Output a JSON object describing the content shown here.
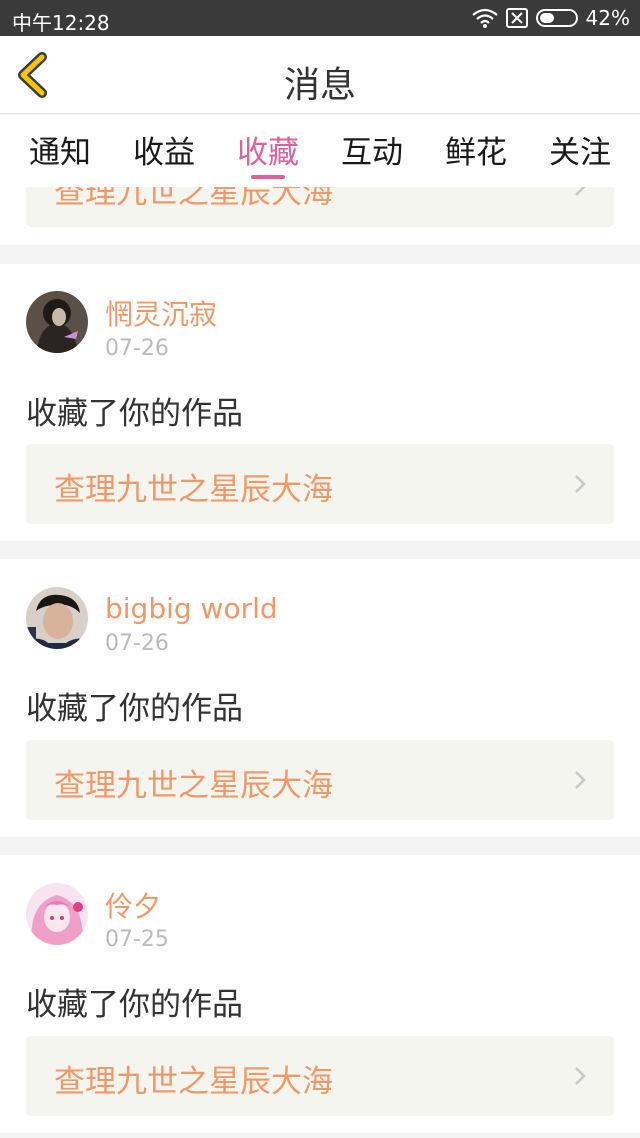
{
  "status_bar": {
    "time": "中午12:28",
    "battery": "42%",
    "battery_level": 0.42,
    "icons": [
      "wifi-icon",
      "sim-no-signal-icon",
      "battery-icon"
    ]
  },
  "header": {
    "title": "消息",
    "back_icon": "chevron-left-icon"
  },
  "tabs": [
    {
      "label": "通知"
    },
    {
      "label": "收益"
    },
    {
      "label": "收藏",
      "active": true
    },
    {
      "label": "互动"
    },
    {
      "label": "鲜花"
    },
    {
      "label": "关注"
    }
  ],
  "items": [
    {
      "work": "查理九世之星辰大海"
    },
    {
      "user": "惘灵沉寂",
      "date": "07-26",
      "action": "收藏了你的作品",
      "work": "查理九世之星辰大海",
      "avatar": "dark-hair-avatar"
    },
    {
      "user": "bigbig world",
      "date": "07-26",
      "action": "收藏了你的作品",
      "work": "查理九世之星辰大海",
      "avatar": "boy-photo-avatar"
    },
    {
      "user": "伶夕",
      "date": "07-25",
      "action": "收藏了你的作品",
      "work": "查理九世之星辰大海",
      "avatar": "pink-anime-avatar"
    }
  ],
  "colors": {
    "accent": "#e0609b",
    "name": "#f09868",
    "back_icon": "#f3c800"
  }
}
